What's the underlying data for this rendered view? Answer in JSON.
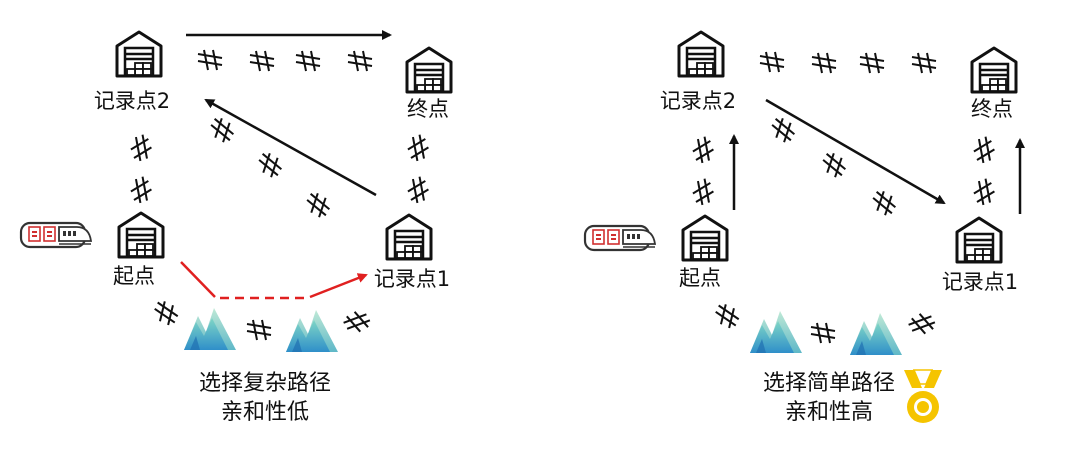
{
  "left_panel": {
    "nodes": {
      "record2": "记录点2",
      "end": "终点",
      "start": "起点",
      "record1": "记录点1"
    },
    "caption": [
      "选择复杂路径",
      "亲和性低"
    ]
  },
  "right_panel": {
    "nodes": {
      "record2": "记录点2",
      "end": "终点",
      "start": "起点",
      "record1": "记录点1"
    },
    "caption": [
      "选择简单路径",
      "亲和性高"
    ]
  },
  "icons": [
    "warehouse-icon",
    "ant-train-icon",
    "mountain-icon",
    "gold-medal-icon",
    "hatch-mark-icon"
  ],
  "colors": {
    "ink": "#111111",
    "path_red": "#e02020",
    "medal_gold": "#f5c400",
    "mountain_teal": "#3aa9b5"
  }
}
